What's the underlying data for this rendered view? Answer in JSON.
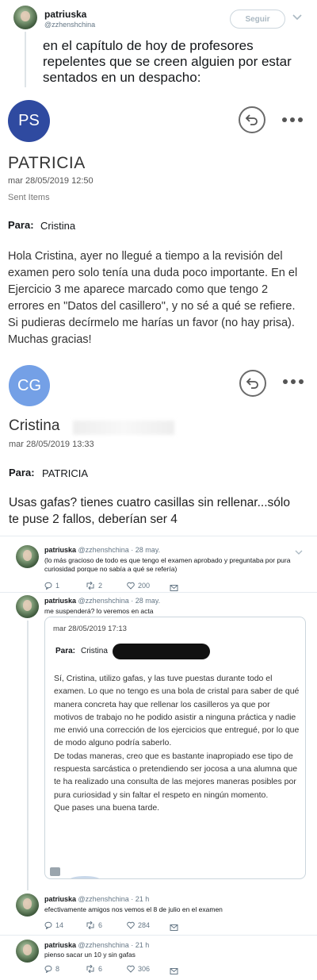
{
  "main_tweet": {
    "name": "patriuska",
    "handle": "@zzhenshchina",
    "follow_label": "Seguir",
    "text": "en el capítulo de hoy de profesores repelentes que se creen alguien por estar sentados en un despacho:"
  },
  "email1": {
    "avatar_initials": "PS",
    "avatar_color": "#2f4aa0",
    "sender": "PATRICIA",
    "date": "mar 28/05/2019 12:50",
    "folder": "Sent Items",
    "to_label": "Para:",
    "to": "Cristina",
    "body": "Hola Cristina, ayer no llegué a tiempo a la revisión del examen pero solo tenía una duda poco importante. En el Ejercicio 3 me aparece marcado como que tengo 2 errores en \"Datos del casillero\", y no sé a qué se refiere. Si pudieras decírmelo me harías un favor (no hay prisa). Muchas gracias!"
  },
  "email2": {
    "avatar_initials": "CG",
    "avatar_color": "#74a0e6",
    "sender": "Cristina",
    "date": "mar 28/05/2019 13:33",
    "to_label": "Para:",
    "to": "PATRICIA",
    "body": "Usas gafas? tienes cuatro casillas sin rellenar...sólo te puse 2 fallos, deberían ser 4"
  },
  "reply1": {
    "name": "patriuska",
    "handle": "@zzhenshchina · 28 may.",
    "text": "(lo más gracioso de todo es que tengo el examen aprobado y preguntaba por pura curiosidad porque no sabía a qué se refería)",
    "replies": "1",
    "retweets": "2",
    "likes": "200"
  },
  "reply2": {
    "name": "patriuska",
    "handle": "@zzhenshchina · 28 may.",
    "text": "me suspenderá? lo veremos en acta",
    "email": {
      "date": "mar 28/05/2019 17:13",
      "to_label": "Para:",
      "to": "Cristina",
      "body": "Sí, Cristina, utilizo gafas, y las tuve puestas durante todo el examen. Lo que no tengo es una bola de cristal para saber de qué manera concreta hay que rellenar los casilleros ya que por motivos de trabajo no he podido asistir a ninguna práctica y nadie me envió una corrección de los ejercicios que entregué, por lo que de modo alguno podría saberlo.\nDe todas maneras, creo que es bastante inapropiado ese tipo de respuesta sarcástica o pretendiendo ser jocosa a una alumna que te ha realizado una consulta de las mejores maneras posibles por pura curiosidad y sin faltar el respeto en ningún momento.\nQue pases una buena tarde."
    }
  },
  "reply3": {
    "name": "patriuska",
    "handle": "@zzhenshchina · 21 h",
    "text": "efectivamente amigos nos vemos el 8 de julio en el examen",
    "replies": "14",
    "retweets": "6",
    "likes": "284"
  },
  "reply4": {
    "name": "patriuska",
    "handle": "@zzhenshchina · 21 h",
    "text": "pienso sacar un 10 y sin gafas",
    "replies": "8",
    "retweets": "6",
    "likes": "306"
  },
  "colors": {
    "like_red": "#e0245e",
    "link_blue": "#1da1f2",
    "text_gray": "#657786"
  }
}
